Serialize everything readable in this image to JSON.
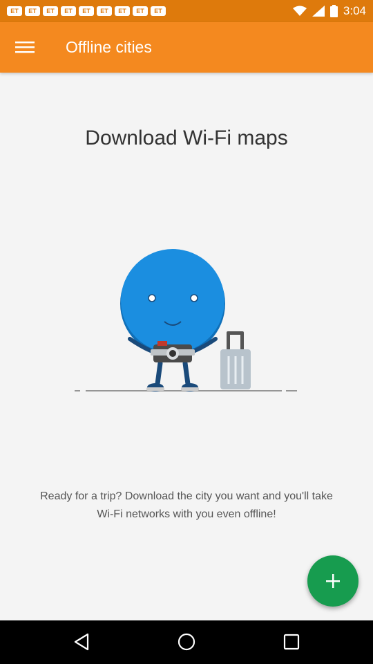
{
  "status_bar": {
    "carrier_icons": [
      "ET",
      "ET",
      "ET",
      "ET",
      "ET",
      "ET",
      "ET",
      "ET",
      "ET"
    ],
    "time": "3:04"
  },
  "app_bar": {
    "title": "Offline cities",
    "menu_icon": "hamburger-menu-icon"
  },
  "main": {
    "heading": "Download Wi-Fi maps",
    "illustration": "traveler-mascot-with-camera-and-suitcase",
    "description": "Ready for a trip? Download the city you want and you'll take Wi-Fi networks with you even offline!"
  },
  "fab": {
    "icon": "plus-icon"
  },
  "nav_bar": {
    "icons": [
      "back-icon",
      "home-icon",
      "recents-icon"
    ]
  },
  "colors": {
    "status_bar": "#de7a0c",
    "app_bar": "#f4891f",
    "fab": "#179c4f",
    "mascot": "#1b8ee0"
  }
}
